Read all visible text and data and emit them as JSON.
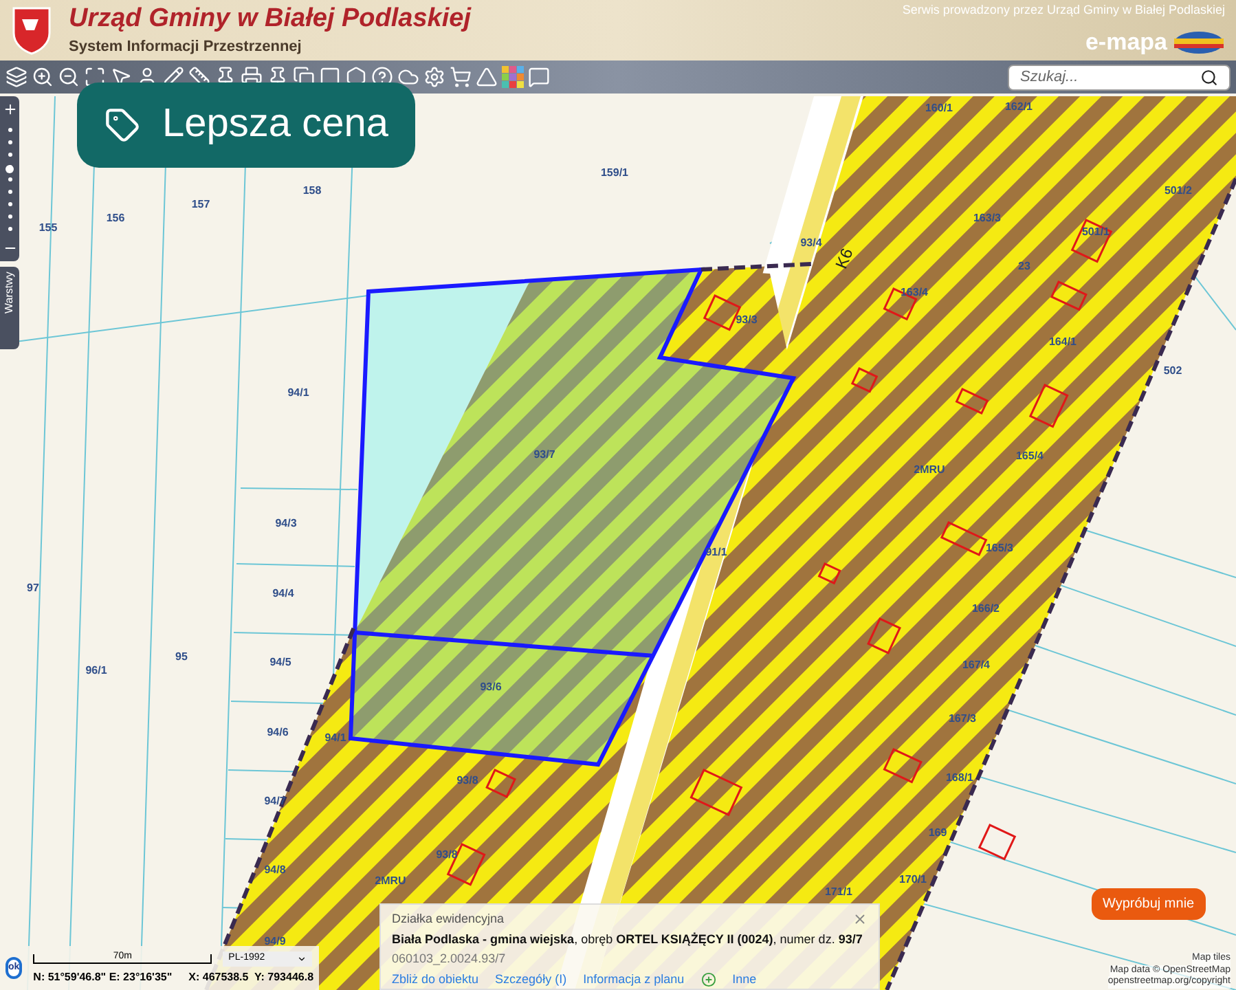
{
  "header": {
    "title": "Urząd Gminy w Białej Podlaskiej",
    "subtitle": "System Informacji Przestrzennej",
    "operator_note": "Serwis prowadzony przez Urząd Gminy w Białej Podlaskiej",
    "brand": "e-mapa"
  },
  "toolbar": {
    "search": {
      "placeholder": "Szukaj..."
    }
  },
  "badge": {
    "label": "Lepsza cena"
  },
  "layers_tab": {
    "label": "Warstwy"
  },
  "zoom": {
    "level": 0.6
  },
  "map": {
    "labels": [
      "155",
      "156",
      "157",
      "158",
      "159/1",
      "93/4",
      "K6",
      "160/1",
      "162/1",
      "163/3",
      "501/2",
      "501/1",
      "23",
      "163/4",
      "93/3",
      "164/1",
      "502",
      "94/1",
      "93/7",
      "2MRU",
      "165/4",
      "165/3",
      "91/1",
      "166/2",
      "94/3",
      "97",
      "94/4",
      "167/4",
      "96/1",
      "95",
      "94/5",
      "93/6",
      "167/3",
      "94/6",
      "94/1",
      "168/1",
      "93/8",
      "94/7",
      "169",
      "93/8",
      "94/8",
      "2MRU",
      "170/1",
      "94/9",
      "171/1"
    ]
  },
  "popup": {
    "heading": "Działka ewidencyjna",
    "description": "**Biała Podlaska - gmina wiejska**, obręb **ORTEL KSIĄŻĘCY II (0024)**, numer dz. **93/7**",
    "code": "060103_2.0024.93/7",
    "links": [
      {
        "label": "Zbliż do obiektu",
        "kind": "link"
      },
      {
        "label": "Szczegóły (I)",
        "kind": "link"
      },
      {
        "label": "Informacja z planu",
        "kind": "link"
      },
      {
        "label": "Inne",
        "kind": "plus"
      }
    ]
  },
  "status": {
    "ok": "ok",
    "scale": "70m",
    "crs": "PL-1992",
    "geo": "N: 51°59'46.8\" E: 23°16'35\"",
    "xy": "X: 467538.5  Y: 793446.8"
  },
  "try_button": {
    "label": "Wypróbuj mnie"
  },
  "attribution": [
    "Map tiles",
    "Map data © OpenStreetMap",
    "openstreetmap.org/copyright"
  ]
}
